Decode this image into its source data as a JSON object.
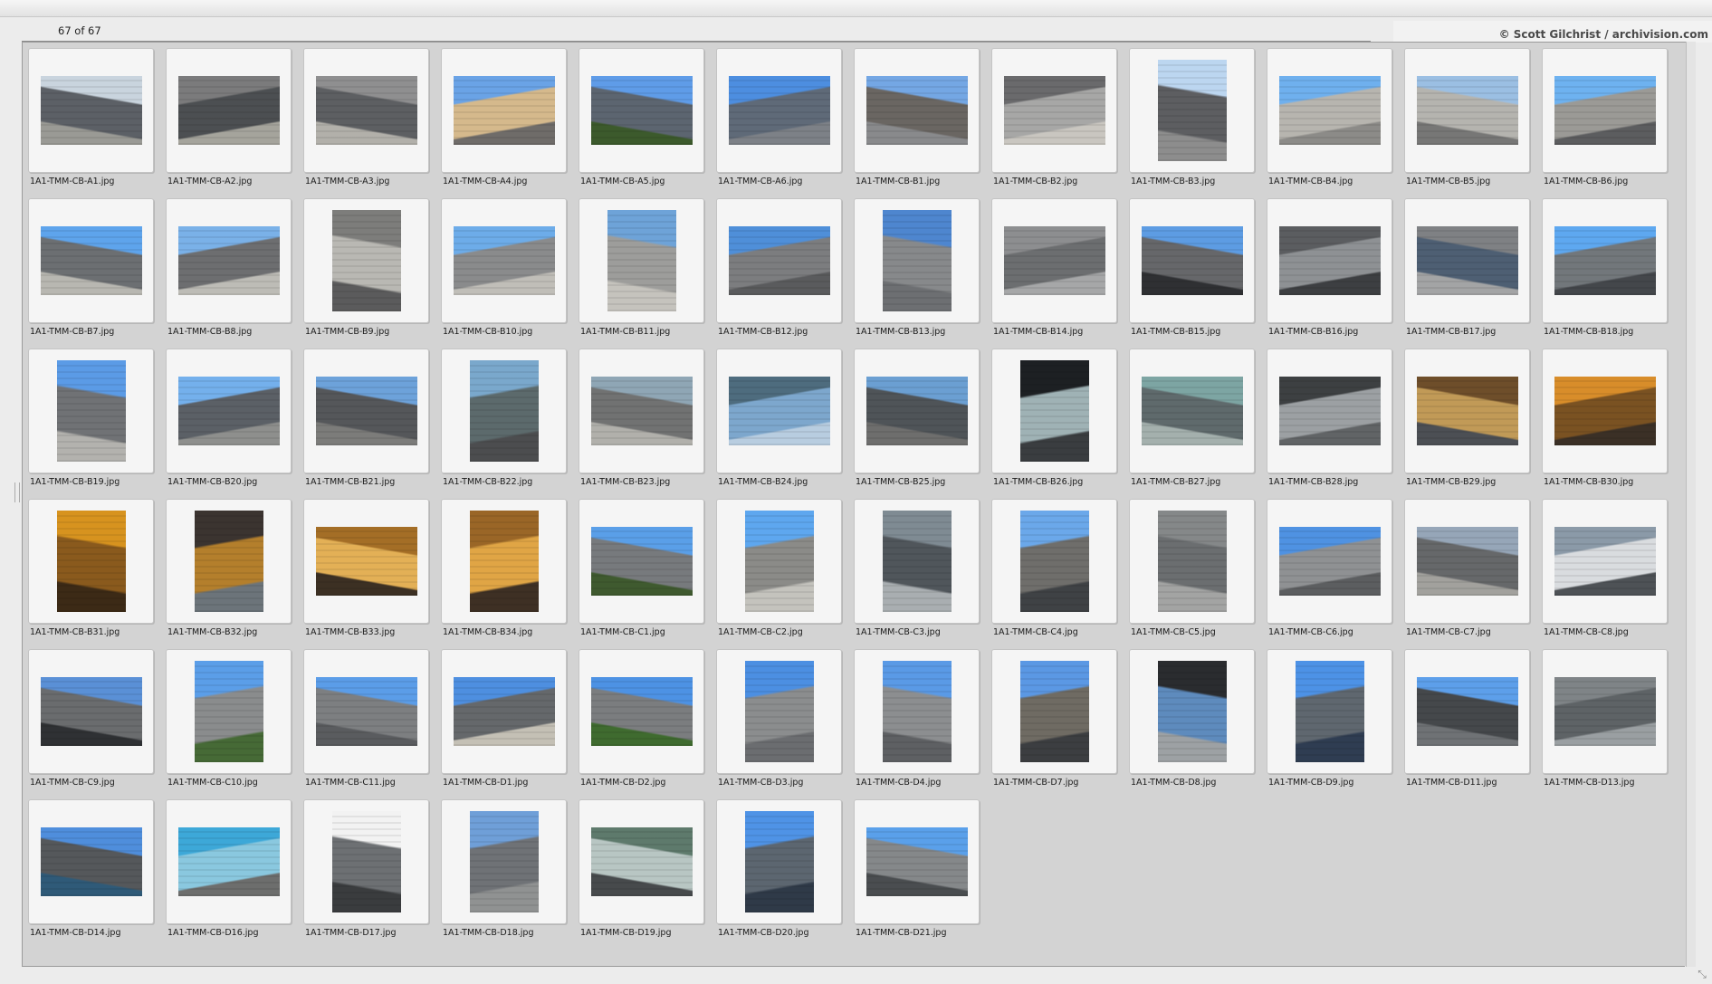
{
  "header": {
    "counter": "67 of 67",
    "credit": "© Scott Gilchrist / archivision.com"
  },
  "thumbnails": [
    {
      "name": "1A1-TMM-CB-A1.jpg",
      "orientation": "landscape",
      "colors": [
        "#c9d4de",
        "#5c6066",
        "#9a9a95"
      ]
    },
    {
      "name": "1A1-TMM-CB-A2.jpg",
      "orientation": "landscape",
      "colors": [
        "#7b7b7c",
        "#4c4f52",
        "#a5a49c"
      ]
    },
    {
      "name": "1A1-TMM-CB-A3.jpg",
      "orientation": "landscape",
      "colors": [
        "#8f8f90",
        "#5d5f62",
        "#b2b0aa"
      ]
    },
    {
      "name": "1A1-TMM-CB-A4.jpg",
      "orientation": "landscape",
      "colors": [
        "#6aa3e6",
        "#d5b98c",
        "#6f6c69"
      ]
    },
    {
      "name": "1A1-TMM-CB-A5.jpg",
      "orientation": "landscape",
      "colors": [
        "#5f9ce8",
        "#5c6570",
        "#3c5a2c"
      ]
    },
    {
      "name": "1A1-TMM-CB-A6.jpg",
      "orientation": "landscape",
      "colors": [
        "#4d8ee0",
        "#5f6a78",
        "#7d8187"
      ]
    },
    {
      "name": "1A1-TMM-CB-B1.jpg",
      "orientation": "landscape",
      "colors": [
        "#74a7e4",
        "#6a6662",
        "#898a8c"
      ]
    },
    {
      "name": "1A1-TMM-CB-B2.jpg",
      "orientation": "landscape",
      "colors": [
        "#6a6a6c",
        "#a7a7a6",
        "#c9c6c0"
      ]
    },
    {
      "name": "1A1-TMM-CB-B3.jpg",
      "orientation": "portrait",
      "colors": [
        "#bcd6f0",
        "#5d5e61",
        "#8d8d8d"
      ]
    },
    {
      "name": "1A1-TMM-CB-B4.jpg",
      "orientation": "landscape",
      "colors": [
        "#6fb0ee",
        "#b7b5af",
        "#8c8b88"
      ]
    },
    {
      "name": "1A1-TMM-CB-B5.jpg",
      "orientation": "landscape",
      "colors": [
        "#9bbfe3",
        "#b5b4af",
        "#777776"
      ]
    },
    {
      "name": "1A1-TMM-CB-B6.jpg",
      "orientation": "landscape",
      "colors": [
        "#6eb2f0",
        "#9b9a96",
        "#5c5d5f"
      ]
    },
    {
      "name": "1A1-TMM-CB-B7.jpg",
      "orientation": "landscape",
      "colors": [
        "#5ea4ec",
        "#6c6f72",
        "#b8b7b1"
      ]
    },
    {
      "name": "1A1-TMM-CB-B8.jpg",
      "orientation": "landscape",
      "colors": [
        "#7ab1e8",
        "#6d6e70",
        "#bdbcb6"
      ]
    },
    {
      "name": "1A1-TMM-CB-B9.jpg",
      "orientation": "portrait",
      "colors": [
        "#7d7d7b",
        "#b9b8b3",
        "#5b5b5c"
      ]
    },
    {
      "name": "1A1-TMM-CB-B10.jpg",
      "orientation": "landscape",
      "colors": [
        "#6dace9",
        "#8a8b8c",
        "#c0beb8"
      ]
    },
    {
      "name": "1A1-TMM-CB-B11.jpg",
      "orientation": "portrait",
      "colors": [
        "#6ea3d8",
        "#9d9d9b",
        "#c5c3bd"
      ]
    },
    {
      "name": "1A1-TMM-CB-B12.jpg",
      "orientation": "landscape",
      "colors": [
        "#4f8fd9",
        "#7c7d7f",
        "#5a5b5d"
      ]
    },
    {
      "name": "1A1-TMM-CB-B13.jpg",
      "orientation": "portrait",
      "colors": [
        "#4e86cf",
        "#87898b",
        "#6d6f72"
      ]
    },
    {
      "name": "1A1-TMM-CB-B14.jpg",
      "orientation": "landscape",
      "colors": [
        "#8d8e90",
        "#6c6e70",
        "#a6a7a8"
      ]
    },
    {
      "name": "1A1-TMM-CB-B15.jpg",
      "orientation": "landscape",
      "colors": [
        "#5d9ce3",
        "#66676a",
        "#2f3033"
      ]
    },
    {
      "name": "1A1-TMM-CB-B16.jpg",
      "orientation": "landscape",
      "colors": [
        "#5b5d60",
        "#8e9194",
        "#3d3f42"
      ]
    },
    {
      "name": "1A1-TMM-CB-B17.jpg",
      "orientation": "landscape",
      "colors": [
        "#7f8184",
        "#4e5f73",
        "#a3a4a5"
      ]
    },
    {
      "name": "1A1-TMM-CB-B18.jpg",
      "orientation": "landscape",
      "colors": [
        "#5ea8f0",
        "#72777b",
        "#44474b"
      ]
    },
    {
      "name": "1A1-TMM-CB-B19.jpg",
      "orientation": "portrait",
      "colors": [
        "#5b9be6",
        "#707275",
        "#b3b2ae"
      ]
    },
    {
      "name": "1A1-TMM-CB-B20.jpg",
      "orientation": "landscape",
      "colors": [
        "#74b0ec",
        "#5b6066",
        "#8e8f8d"
      ]
    },
    {
      "name": "1A1-TMM-CB-B21.jpg",
      "orientation": "landscape",
      "colors": [
        "#6da2da",
        "#55575a",
        "#7c7c7a"
      ]
    },
    {
      "name": "1A1-TMM-CB-B22.jpg",
      "orientation": "portrait",
      "colors": [
        "#7aa8cc",
        "#5c6a6c",
        "#4c4d4f"
      ]
    },
    {
      "name": "1A1-TMM-CB-B23.jpg",
      "orientation": "landscape",
      "colors": [
        "#8fa6b5",
        "#717272",
        "#b1b0ab"
      ]
    },
    {
      "name": "1A1-TMM-CB-B24.jpg",
      "orientation": "landscape",
      "colors": [
        "#4e6c7e",
        "#7da7cd",
        "#b8cde0"
      ]
    },
    {
      "name": "1A1-TMM-CB-B25.jpg",
      "orientation": "landscape",
      "colors": [
        "#6b9fd2",
        "#4f5458",
        "#6e6e6d"
      ]
    },
    {
      "name": "1A1-TMM-CB-B26.jpg",
      "orientation": "portrait",
      "colors": [
        "#1d2023",
        "#9fb2b5",
        "#3a3d40"
      ]
    },
    {
      "name": "1A1-TMM-CB-B27.jpg",
      "orientation": "landscape",
      "colors": [
        "#7da5a3",
        "#5f6a6c",
        "#a4b0ad"
      ]
    },
    {
      "name": "1A1-TMM-CB-B28.jpg",
      "orientation": "landscape",
      "colors": [
        "#3d4042",
        "#9ca0a3",
        "#616466"
      ]
    },
    {
      "name": "1A1-TMM-CB-B29.jpg",
      "orientation": "landscape",
      "colors": [
        "#6e4e2a",
        "#c19a57",
        "#4c4f54"
      ]
    },
    {
      "name": "1A1-TMM-CB-B30.jpg",
      "orientation": "landscape",
      "colors": [
        "#d88d2a",
        "#7a5222",
        "#3b3026"
      ]
    },
    {
      "name": "1A1-TMM-CB-B31.jpg",
      "orientation": "portrait",
      "colors": [
        "#d7931f",
        "#8a5a1d",
        "#3c2a16"
      ]
    },
    {
      "name": "1A1-TMM-CB-B32.jpg",
      "orientation": "portrait",
      "colors": [
        "#3b3430",
        "#b47f2c",
        "#6c747a"
      ]
    },
    {
      "name": "1A1-TMM-CB-B33.jpg",
      "orientation": "landscape",
      "colors": [
        "#a46e26",
        "#e3b056",
        "#3c3023"
      ]
    },
    {
      "name": "1A1-TMM-CB-B34.jpg",
      "orientation": "portrait",
      "colors": [
        "#9a6627",
        "#e0a545",
        "#3e3024"
      ]
    },
    {
      "name": "1A1-TMM-CB-C1.jpg",
      "orientation": "landscape",
      "colors": [
        "#5a9fe8",
        "#777a7d",
        "#3f5a2f"
      ]
    },
    {
      "name": "1A1-TMM-CB-C2.jpg",
      "orientation": "portrait",
      "colors": [
        "#5ea7ef",
        "#8b8b88",
        "#c4c3bd"
      ]
    },
    {
      "name": "1A1-TMM-CB-C3.jpg",
      "orientation": "portrait",
      "colors": [
        "#7f8b93",
        "#50565b",
        "#a9aeb1"
      ]
    },
    {
      "name": "1A1-TMM-CB-C4.jpg",
      "orientation": "portrait",
      "colors": [
        "#6ba8ea",
        "#6f6e6b",
        "#3f4245"
      ]
    },
    {
      "name": "1A1-TMM-CB-C5.jpg",
      "orientation": "portrait",
      "colors": [
        "#858889",
        "#6b6e70",
        "#a3a4a3"
      ]
    },
    {
      "name": "1A1-TMM-CB-C6.jpg",
      "orientation": "landscape",
      "colors": [
        "#4f92e2",
        "#8f9193",
        "#5c5e60"
      ]
    },
    {
      "name": "1A1-TMM-CB-C7.jpg",
      "orientation": "landscape",
      "colors": [
        "#96a6b8",
        "#66686a",
        "#a2a19d"
      ]
    },
    {
      "name": "1A1-TMM-CB-C8.jpg",
      "orientation": "landscape",
      "colors": [
        "#8b9aa8",
        "#d9dcdf",
        "#4e5256"
      ]
    },
    {
      "name": "1A1-TMM-CB-C9.jpg",
      "orientation": "landscape",
      "colors": [
        "#5a90d6",
        "#6a6c6e",
        "#2f3134"
      ]
    },
    {
      "name": "1A1-TMM-CB-C10.jpg",
      "orientation": "portrait",
      "colors": [
        "#5b9ee8",
        "#8a8c8d",
        "#466a36"
      ]
    },
    {
      "name": "1A1-TMM-CB-C11.jpg",
      "orientation": "landscape",
      "colors": [
        "#5b9de8",
        "#7d7f81",
        "#5a5c5f"
      ]
    },
    {
      "name": "1A1-TMM-CB-D1.jpg",
      "orientation": "landscape",
      "colors": [
        "#4e8fe0",
        "#65686b",
        "#c4c0b5"
      ]
    },
    {
      "name": "1A1-TMM-CB-D2.jpg",
      "orientation": "landscape",
      "colors": [
        "#4d92e4",
        "#7b7d7f",
        "#3f6b2f"
      ]
    },
    {
      "name": "1A1-TMM-CB-D3.jpg",
      "orientation": "portrait",
      "colors": [
        "#4c8fe2",
        "#8b8d8e",
        "#6b6d70"
      ]
    },
    {
      "name": "1A1-TMM-CB-D4.jpg",
      "orientation": "portrait",
      "colors": [
        "#5a9ae6",
        "#8c8e90",
        "#5e6063"
      ]
    },
    {
      "name": "1A1-TMM-CB-D7.jpg",
      "orientation": "portrait",
      "colors": [
        "#5b98e4",
        "#6f6b63",
        "#3c3e41"
      ]
    },
    {
      "name": "1A1-TMM-CB-D8.jpg",
      "orientation": "portrait",
      "colors": [
        "#2a2c2f",
        "#5e8bbd",
        "#9da1a4"
      ]
    },
    {
      "name": "1A1-TMM-CB-D9.jpg",
      "orientation": "portrait",
      "colors": [
        "#4d92e6",
        "#5f676f",
        "#2f3d52"
      ]
    },
    {
      "name": "1A1-TMM-CB-D11.jpg",
      "orientation": "landscape",
      "colors": [
        "#5d9fea",
        "#45484b",
        "#6f7275"
      ]
    },
    {
      "name": "1A1-TMM-CB-D13.jpg",
      "orientation": "landscape",
      "colors": [
        "#7f8487",
        "#5e6366",
        "#9a9fa2"
      ]
    },
    {
      "name": "1A1-TMM-CB-D14.jpg",
      "orientation": "landscape",
      "colors": [
        "#4f8edc",
        "#55585b",
        "#2f5a78"
      ]
    },
    {
      "name": "1A1-TMM-CB-D16.jpg",
      "orientation": "landscape",
      "colors": [
        "#3da8d8",
        "#8ac8df",
        "#6d6e6d"
      ]
    },
    {
      "name": "1A1-TMM-CB-D17.jpg",
      "orientation": "portrait",
      "colors": [
        "#f2f2f2",
        "#6d7073",
        "#3a3c3e"
      ]
    },
    {
      "name": "1A1-TMM-CB-D18.jpg",
      "orientation": "portrait",
      "colors": [
        "#6f9fd8",
        "#6f7276",
        "#909292"
      ]
    },
    {
      "name": "1A1-TMM-CB-D19.jpg",
      "orientation": "landscape",
      "colors": [
        "#5e7a6c",
        "#b8c6c3",
        "#474a4c"
      ]
    },
    {
      "name": "1A1-TMM-CB-D20.jpg",
      "orientation": "portrait",
      "colors": [
        "#4f93e6",
        "#5c6670",
        "#2f3a48"
      ]
    },
    {
      "name": "1A1-TMM-CB-D21.jpg",
      "orientation": "landscape",
      "colors": [
        "#5aa0ea",
        "#85888a",
        "#4a4d50"
      ]
    }
  ]
}
